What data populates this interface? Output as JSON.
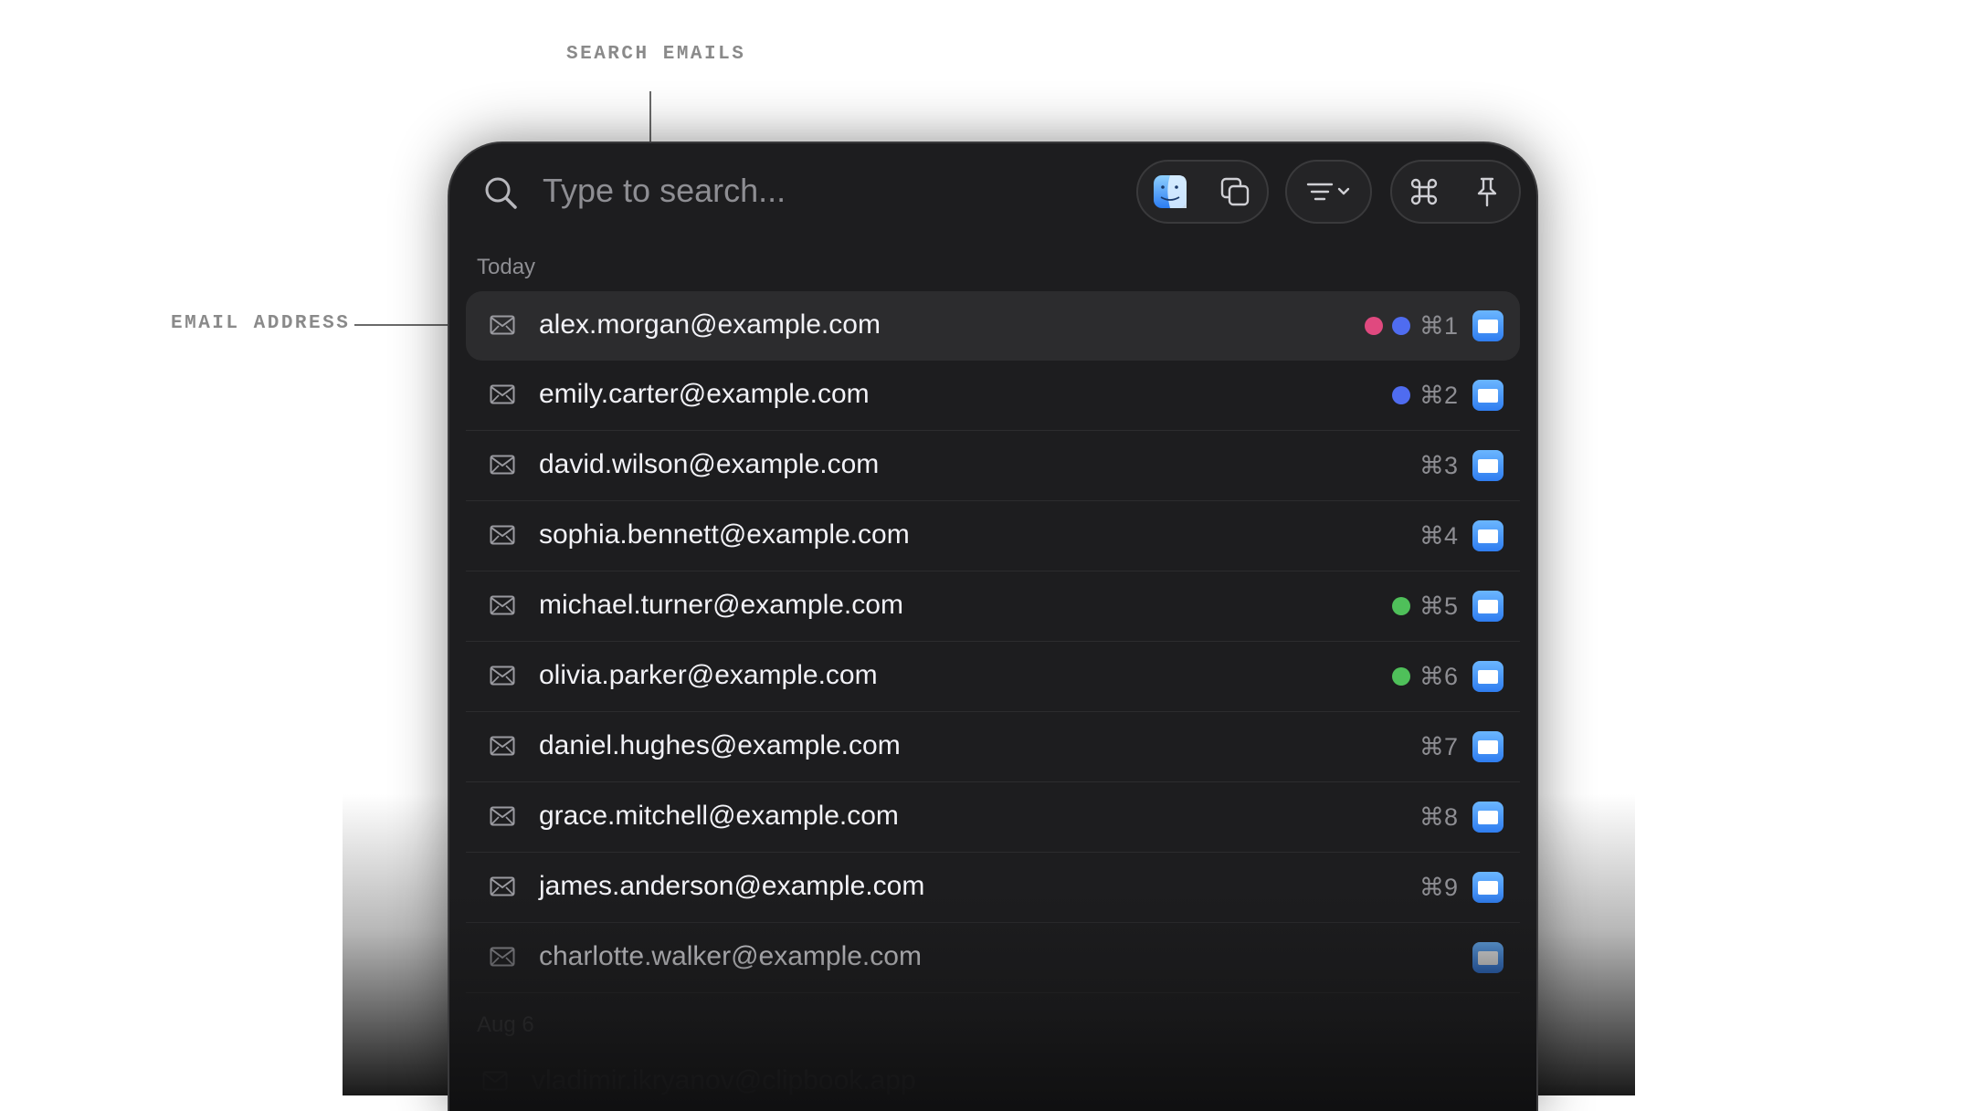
{
  "callouts": {
    "search": "SEARCH EMAILS",
    "email": "EMAIL ADDRESS"
  },
  "search": {
    "placeholder": "Type to search..."
  },
  "toolbar": {
    "finder_icon": "finder-icon",
    "copy_icon": "copy-icon",
    "filter_icon": "filter-icon",
    "command_icon": "command-icon",
    "pin_icon": "pin-icon"
  },
  "sections": {
    "today": "Today",
    "aug": "Aug 6"
  },
  "colors": {
    "pink": "#e0497f",
    "blue": "#4f6cf0",
    "green": "#4fc05a"
  },
  "items": [
    {
      "email": "alex.morgan@example.com",
      "shortcut": "⌘1",
      "dots": [
        "pink",
        "blue"
      ],
      "selected": true
    },
    {
      "email": "emily.carter@example.com",
      "shortcut": "⌘2",
      "dots": [
        "blue"
      ]
    },
    {
      "email": "david.wilson@example.com",
      "shortcut": "⌘3",
      "dots": []
    },
    {
      "email": "sophia.bennett@example.com",
      "shortcut": "⌘4",
      "dots": []
    },
    {
      "email": "michael.turner@example.com",
      "shortcut": "⌘5",
      "dots": [
        "green"
      ]
    },
    {
      "email": "olivia.parker@example.com",
      "shortcut": "⌘6",
      "dots": [
        "green"
      ]
    },
    {
      "email": "daniel.hughes@example.com",
      "shortcut": "⌘7",
      "dots": []
    },
    {
      "email": "grace.mitchell@example.com",
      "shortcut": "⌘8",
      "dots": []
    },
    {
      "email": "james.anderson@example.com",
      "shortcut": "⌘9",
      "dots": []
    },
    {
      "email": "charlotte.walker@example.com",
      "shortcut": "",
      "dots": []
    }
  ],
  "ghost_item": {
    "email": "vladimir.ikryanov@clipbook.app"
  }
}
